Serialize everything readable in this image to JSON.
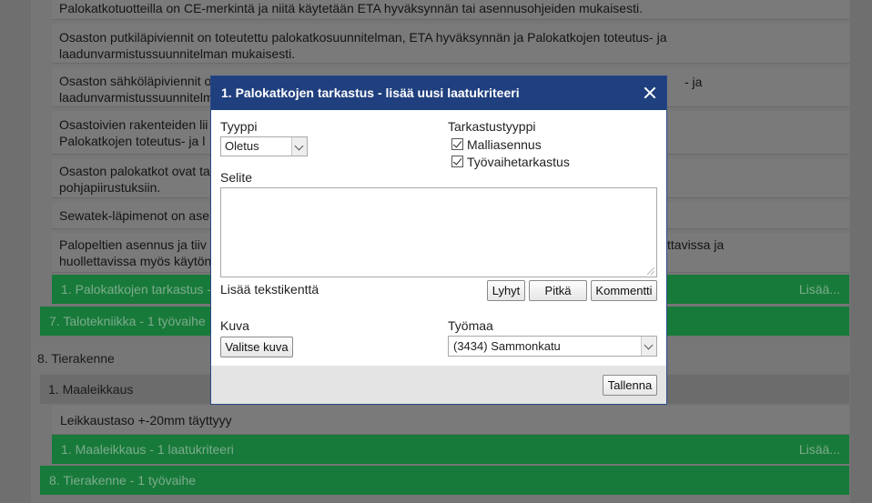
{
  "background": {
    "criteria": [
      {
        "lines": [
          "Palokatkotuotteilla on CE-merkintä ja niitä käytetään ETA hyväksynnän tai asennusohjeiden mukaisesti."
        ]
      },
      {
        "lines": [
          "Osaston putkiläpiviennit on toteutettu palokatkosuunnitelman, ETA hyväksynnän ja Palokatkojen toteutus- ja",
          "laadunvarmistussuunnitelman mukaisesti."
        ]
      },
      {
        "lines": [
          "Osaston sähköläpiviennit o",
          "laadunvarmistussuunnitelm"
        ],
        "right_text": "- ja"
      },
      {
        "lines": [
          "Osastoivien rakenteiden lii",
          "Palokatkojen toteutus- ja l"
        ]
      },
      {
        "lines": [
          "Osaston palokatkot ovat ta",
          "pohjapiirustuksiin."
        ]
      },
      {
        "lines": [
          "Sewatek-läpimenot on ase"
        ]
      },
      {
        "lines": [
          "Palopeltien asennus ja tiiv",
          "huollettavissa myös käytön"
        ],
        "right_text": "ttavissa ja"
      }
    ],
    "bar_criteria_1": {
      "label": "1. Palokatkojen tarkastus -",
      "more": "Lisää..."
    },
    "bar_phase_7": {
      "label": "7. Talotekniikka - 1 työvaihe"
    },
    "section_8": {
      "title": "8. Tierakenne"
    },
    "subsection_1": {
      "title": "1. Maaleikkaus"
    },
    "criterion_maaleikkaus": {
      "text": "Leikkaustaso +-20mm täyttyyy"
    },
    "bar_criteria_maaleikkaus": {
      "label": "1. Maaleikkaus - 1 laatukriteeri",
      "more": "Lisää..."
    },
    "bar_phase_8": {
      "label": "8. Tierakenne - 1 työvaihe"
    }
  },
  "modal": {
    "title": "1. Palokatkojen tarkastus - lisää uusi laatukriteeri",
    "type_label": "Tyyppi",
    "type_value": "Oletus",
    "inspection_type_label": "Tarkastustyyppi",
    "checkboxes": [
      {
        "label": "Malliasennus",
        "checked": true
      },
      {
        "label": "Työvaihetarkastus",
        "checked": true
      }
    ],
    "description_label": "Selite",
    "description_value": "",
    "add_textfield_label": "Lisää tekstikenttä",
    "buttons": {
      "short": "Lyhyt",
      "long": "Pitkä",
      "comment": "Kommentti",
      "choose_image": "Valitse kuva",
      "save": "Tallenna"
    },
    "image_label": "Kuva",
    "site_label": "Työmaa",
    "site_value": "(3434) Sammonkatu"
  }
}
